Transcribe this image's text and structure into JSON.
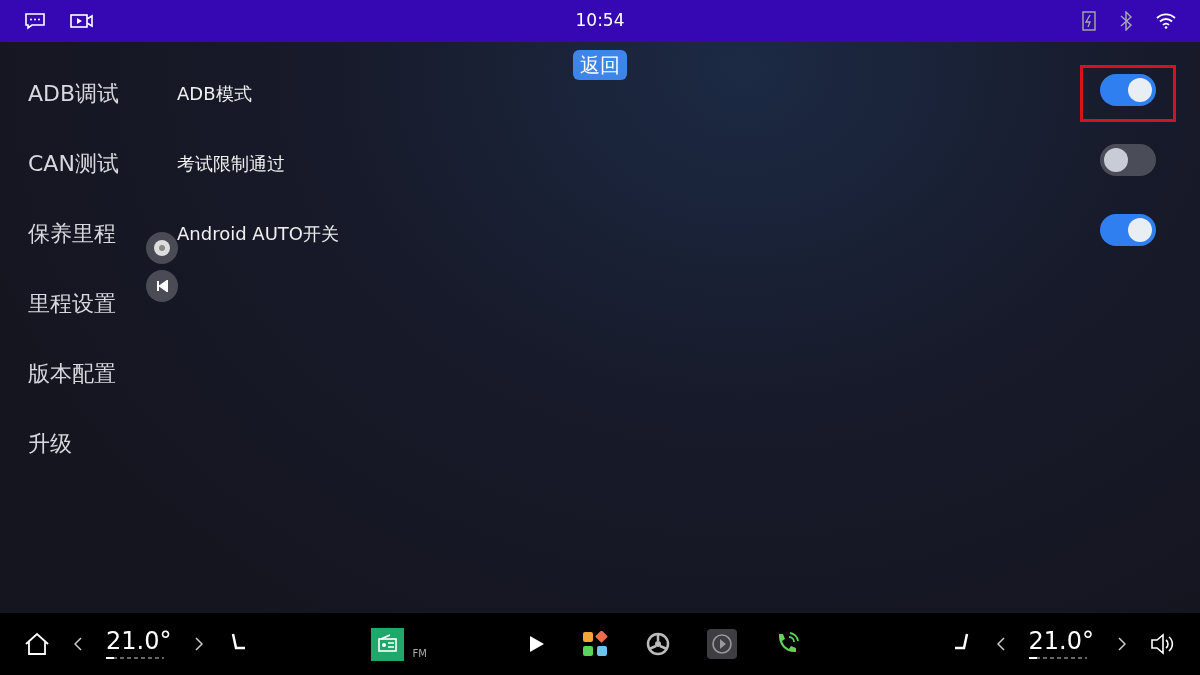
{
  "status_bar": {
    "time": "10:54"
  },
  "back_button": "返回",
  "sidebar": {
    "items": [
      {
        "label": "ADB调试"
      },
      {
        "label": "CAN测试"
      },
      {
        "label": "保养里程"
      },
      {
        "label": "里程设置"
      },
      {
        "label": "版本配置"
      },
      {
        "label": "升级"
      }
    ]
  },
  "settings": [
    {
      "label": "ADB模式",
      "on": true,
      "highlighted": true
    },
    {
      "label": "考试限制通过",
      "on": false,
      "highlighted": false
    },
    {
      "label": "Android AUTO开关",
      "on": true,
      "highlighted": false
    }
  ],
  "dock": {
    "left_temp": "21.0°",
    "radio_label": "FM",
    "right_temp": "21.0°"
  }
}
